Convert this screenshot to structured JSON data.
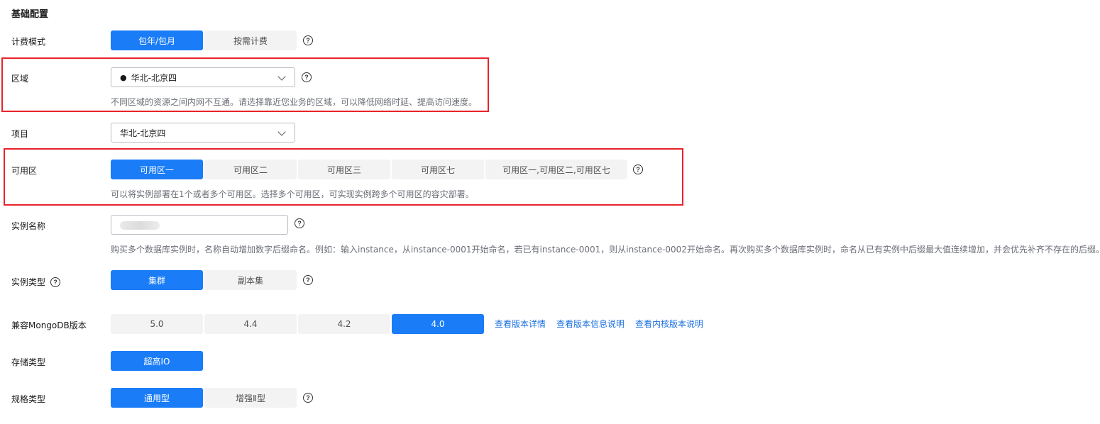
{
  "section_title": "基础配置",
  "billing": {
    "label": "计费模式",
    "options": [
      "包年/包月",
      "按需计费"
    ],
    "selected": "包年/包月"
  },
  "region": {
    "label": "区域",
    "value": "华北-北京四",
    "hint": "不同区域的资源之间内网不互通。请选择靠近您业务的区域，可以降低网络时延、提高访问速度。"
  },
  "project": {
    "label": "项目",
    "value": "华北-北京四"
  },
  "az": {
    "label": "可用区",
    "options": [
      "可用区一",
      "可用区二",
      "可用区三",
      "可用区七",
      "可用区一,可用区二,可用区七"
    ],
    "selected": "可用区一",
    "hint": "可以将实例部署在1个或者多个可用区。选择多个可用区，可实现实例跨多个可用区的容灾部署。"
  },
  "instance_name": {
    "label": "实例名称",
    "hint": "购买多个数据库实例时，名称自动增加数字后缀命名。例如：输入instance，从instance-0001开始命名，若已有instance-0001，则从instance-0002开始命名。再次购买多个数据库实例时，命名从已有实例中后缀最大值连续增加，并会优先补齐不存在的后缀。"
  },
  "instance_type": {
    "label": "实例类型",
    "options": [
      "集群",
      "副本集"
    ],
    "selected": "集群"
  },
  "mongo_version": {
    "label": "兼容MongoDB版本",
    "options": [
      "5.0",
      "4.4",
      "4.2",
      "4.0"
    ],
    "selected": "4.0",
    "links": [
      "查看版本详情",
      "查看版本信息说明",
      "查看内核版本说明"
    ]
  },
  "storage_type": {
    "label": "存储类型",
    "options": [
      "超高IO"
    ],
    "selected": "超高IO"
  },
  "spec_type": {
    "label": "规格类型",
    "options": [
      "通用型",
      "增强Ⅱ型"
    ],
    "selected": "通用型"
  },
  "colors": {
    "accent": "#1a7cf7",
    "highlight_border": "#e8232a",
    "link": "#1a6fe0"
  }
}
